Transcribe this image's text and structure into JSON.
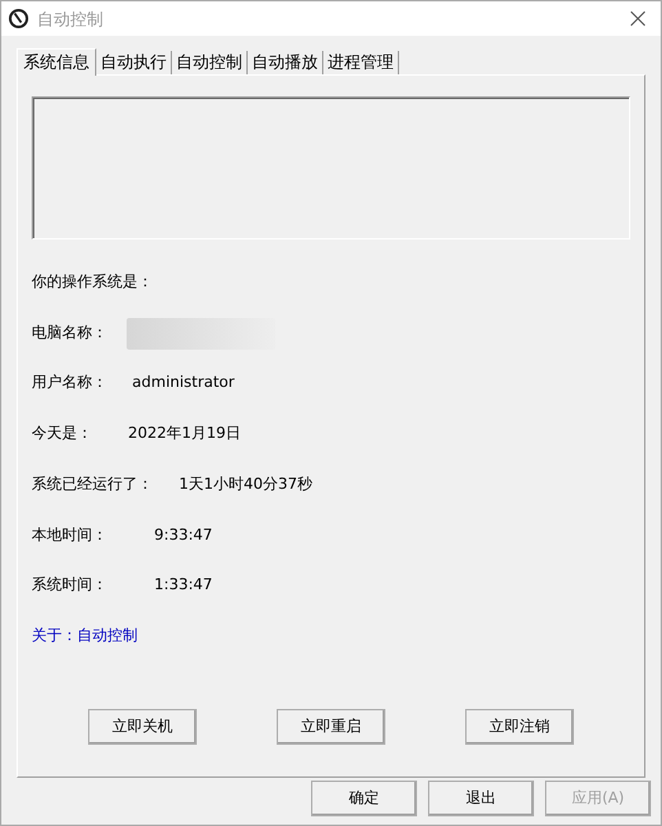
{
  "window": {
    "title": "自动控制"
  },
  "tabs": [
    {
      "label": "系统信息",
      "selected": true
    },
    {
      "label": "自动执行",
      "selected": false
    },
    {
      "label": "自动控制",
      "selected": false
    },
    {
      "label": "自动播放",
      "selected": false
    },
    {
      "label": "进程管理",
      "selected": false
    }
  ],
  "info_rows": [
    {
      "kind": "label",
      "label": "你的操作系统是："
    },
    {
      "kind": "redacted",
      "label": "电脑名称："
    },
    {
      "kind": "value",
      "label": "用户名称：",
      "value": "administrator"
    },
    {
      "kind": "value",
      "label": "今天是：",
      "value": "2022年1月19日"
    },
    {
      "kind": "value",
      "label": "系统已经运行了：",
      "value": "1天1小时40分37秒"
    },
    {
      "kind": "value",
      "label": "本地时间：",
      "value": "9:33:47"
    },
    {
      "kind": "value",
      "label": "系统时间：",
      "value": "1:33:47"
    },
    {
      "kind": "link",
      "label": "关于：自动控制"
    }
  ],
  "actions": [
    "立即关机",
    "立即重启",
    "立即注销"
  ],
  "dialog_buttons": [
    {
      "label": "确定",
      "disabled": false
    },
    {
      "label": "退出",
      "disabled": false
    },
    {
      "label": "应用(A)",
      "disabled": true
    }
  ]
}
